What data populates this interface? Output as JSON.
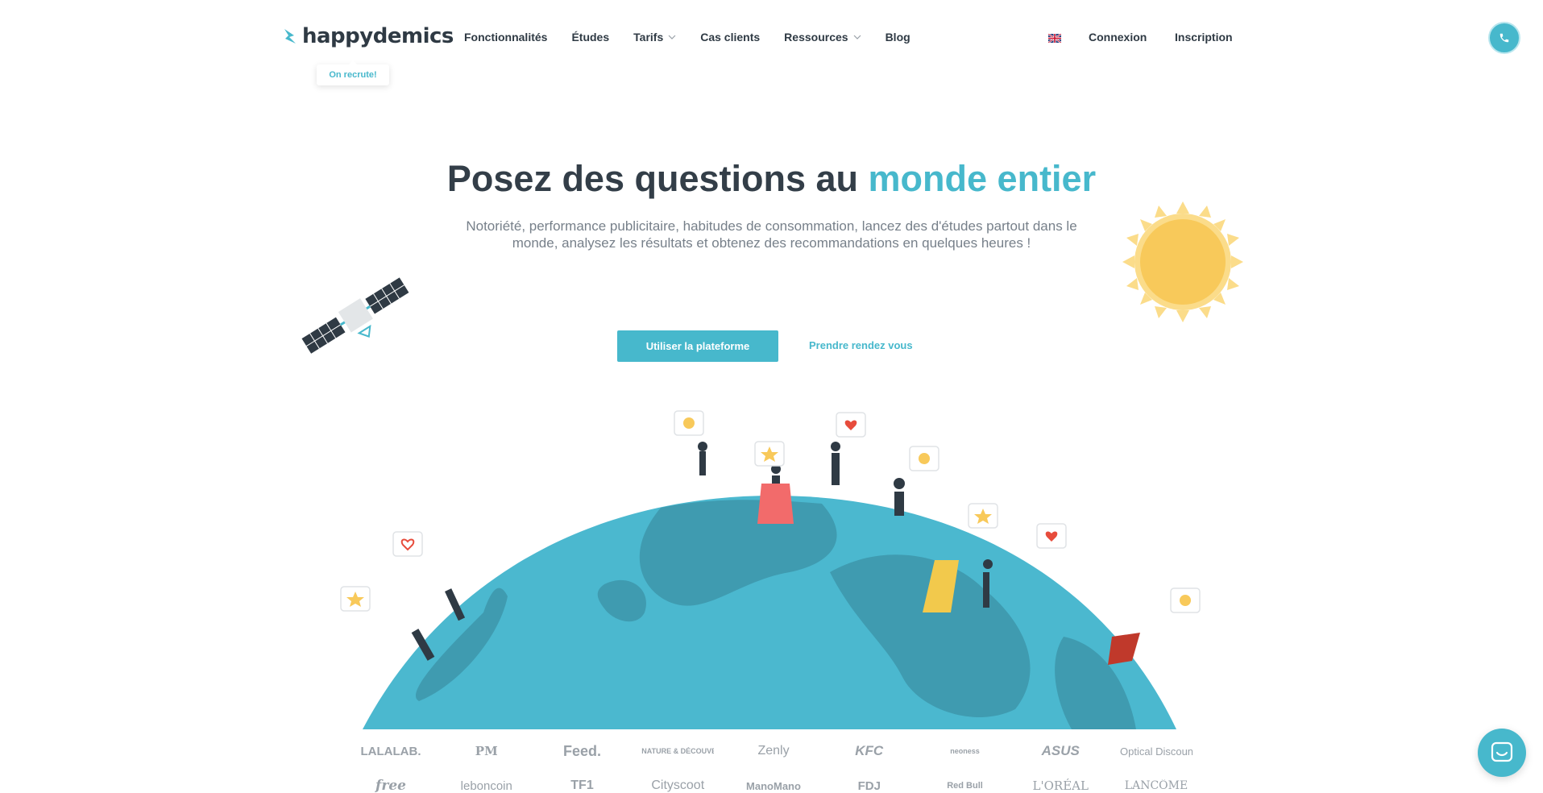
{
  "brand": {
    "name": "happydemics",
    "accent_color": "#47b8cc",
    "dark_color": "#2f3a44"
  },
  "recruit_badge": "On recrute!",
  "nav": {
    "items": [
      {
        "label": "Fonctionnalités",
        "has_dropdown": false
      },
      {
        "label": "Études",
        "has_dropdown": false
      },
      {
        "label": "Tarifs",
        "has_dropdown": true
      },
      {
        "label": "Cas clients",
        "has_dropdown": false
      },
      {
        "label": "Ressources",
        "has_dropdown": true
      },
      {
        "label": "Blog",
        "has_dropdown": false
      }
    ],
    "language_icon": "uk-flag-icon",
    "login": "Connexion",
    "signup": "Inscription",
    "phone_icon": "phone-icon"
  },
  "hero": {
    "title_start": "Posez des questions au",
    "title_accent": "monde entier",
    "subtitle": "Notoriété, performance publicitaire, habitudes de consommation, lancez des d'études partout dans le monde, analysez les résultats et obtenez des recommandations en quelques heures !",
    "primary_cta": "Utiliser la plateforme",
    "secondary_cta": "Prendre rendez vous"
  },
  "client_logos": {
    "row1": [
      "LALALAB.",
      "PM",
      "Feed.",
      "NATURE & DÉCOUVERTES",
      "Zenly",
      "KFC",
      "neoness",
      "ASUS",
      "Optical Discount"
    ],
    "row2": [
      "free",
      "leboncoin",
      "TF1",
      "Cityscoot",
      "ManoMano",
      "FDJ",
      "Red Bull",
      "L'ORÉAL",
      "LANCÔME"
    ]
  },
  "chat_icon": "chat-icon"
}
